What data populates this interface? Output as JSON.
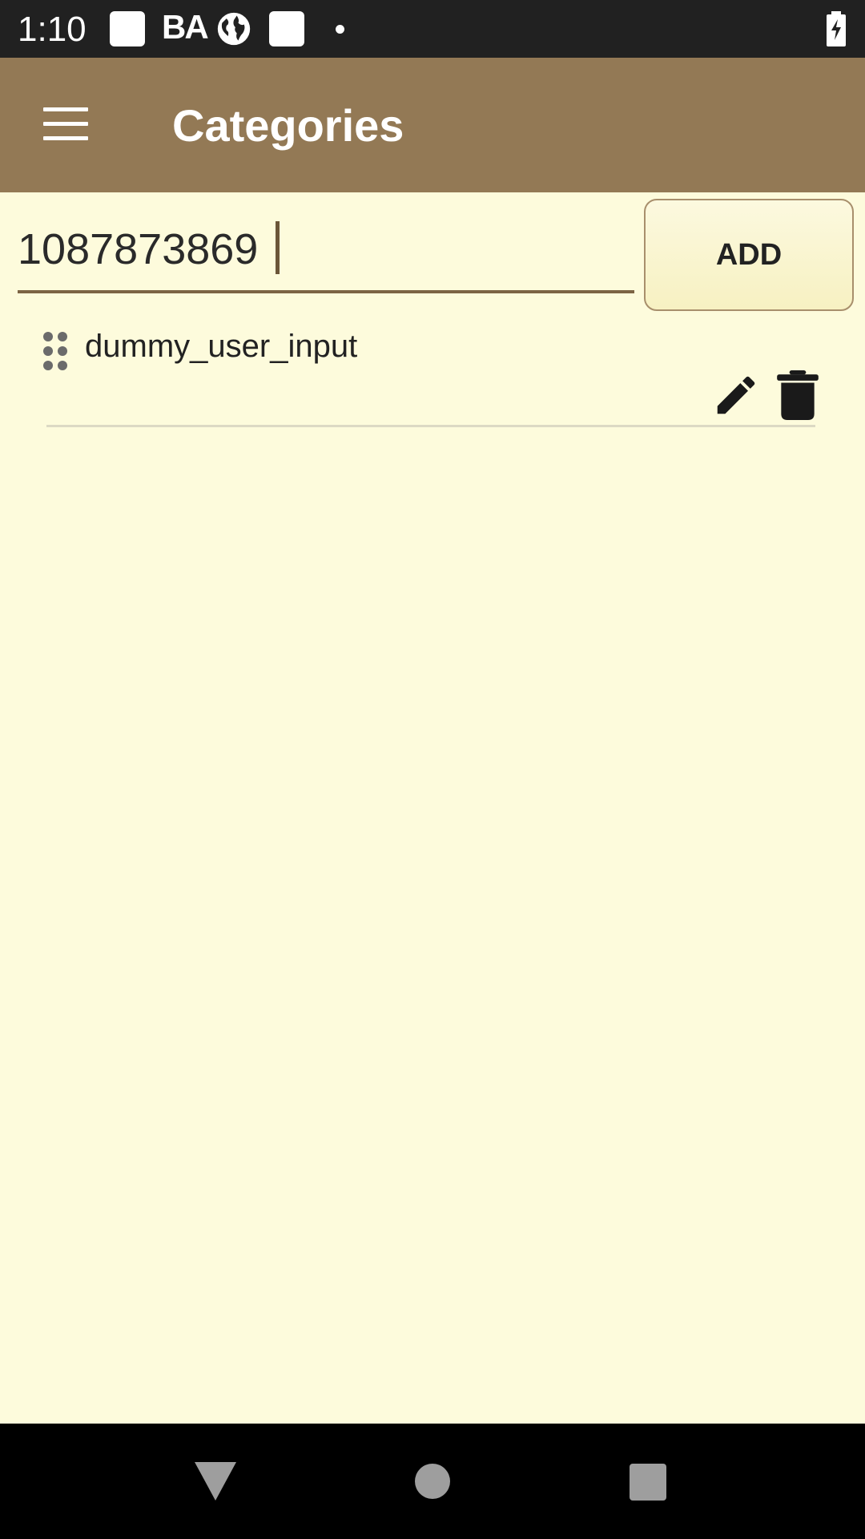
{
  "status_bar": {
    "time": "1:10",
    "carrier_badge": "BA",
    "icons": [
      "square-notification-icon",
      "ba-icon",
      "globe-icon",
      "square-notification-icon",
      "dot-icon",
      "battery-charging-icon"
    ]
  },
  "app_bar": {
    "title": "Categories",
    "menu_icon": "hamburger-menu-icon",
    "background_color": "#937955"
  },
  "add_row": {
    "input_value": "1087873869",
    "button_label": "ADD"
  },
  "categories": [
    {
      "label": "dummy_user_input",
      "actions": [
        "edit-icon",
        "delete-icon"
      ]
    }
  ],
  "colors": {
    "background": "#fdfbdc",
    "accent": "#7c6444"
  },
  "nav_bar": {
    "icons": [
      "back-icon",
      "home-icon",
      "recents-icon"
    ]
  }
}
